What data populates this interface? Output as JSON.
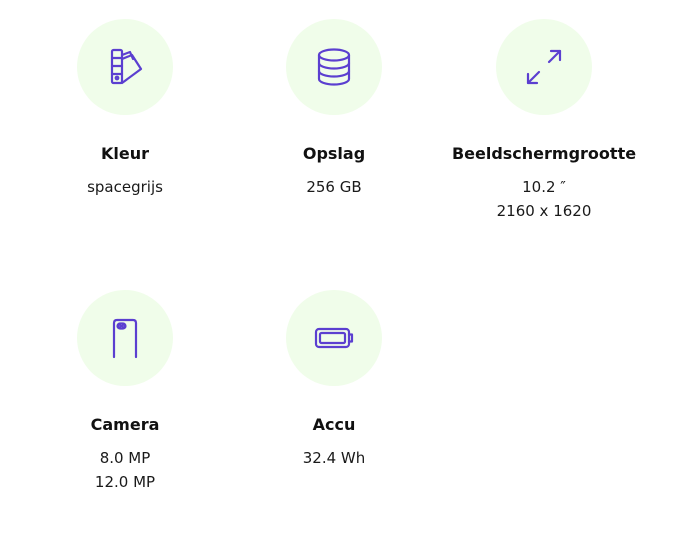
{
  "specs": {
    "kleur": {
      "label": "Kleur",
      "icon": "color-swatch-icon",
      "values": [
        "spacegrijs"
      ]
    },
    "opslag": {
      "label": "Opslag",
      "icon": "storage-database-icon",
      "values": [
        "256 GB"
      ]
    },
    "scherm": {
      "label": "Beeldschermgrootte",
      "icon": "screen-size-arrows-icon",
      "values": [
        "10.2 ″",
        "2160 x 1620"
      ]
    },
    "camera": {
      "label": "Camera",
      "icon": "phone-camera-icon",
      "values": [
        "8.0 MP",
        "12.0 MP"
      ]
    },
    "accu": {
      "label": "Accu",
      "icon": "battery-icon",
      "values": [
        "32.4 Wh"
      ]
    }
  },
  "colors": {
    "icon_stroke": "#5b3fd0",
    "icon_background": "#f0fdea",
    "text": "#1a1a1a"
  }
}
